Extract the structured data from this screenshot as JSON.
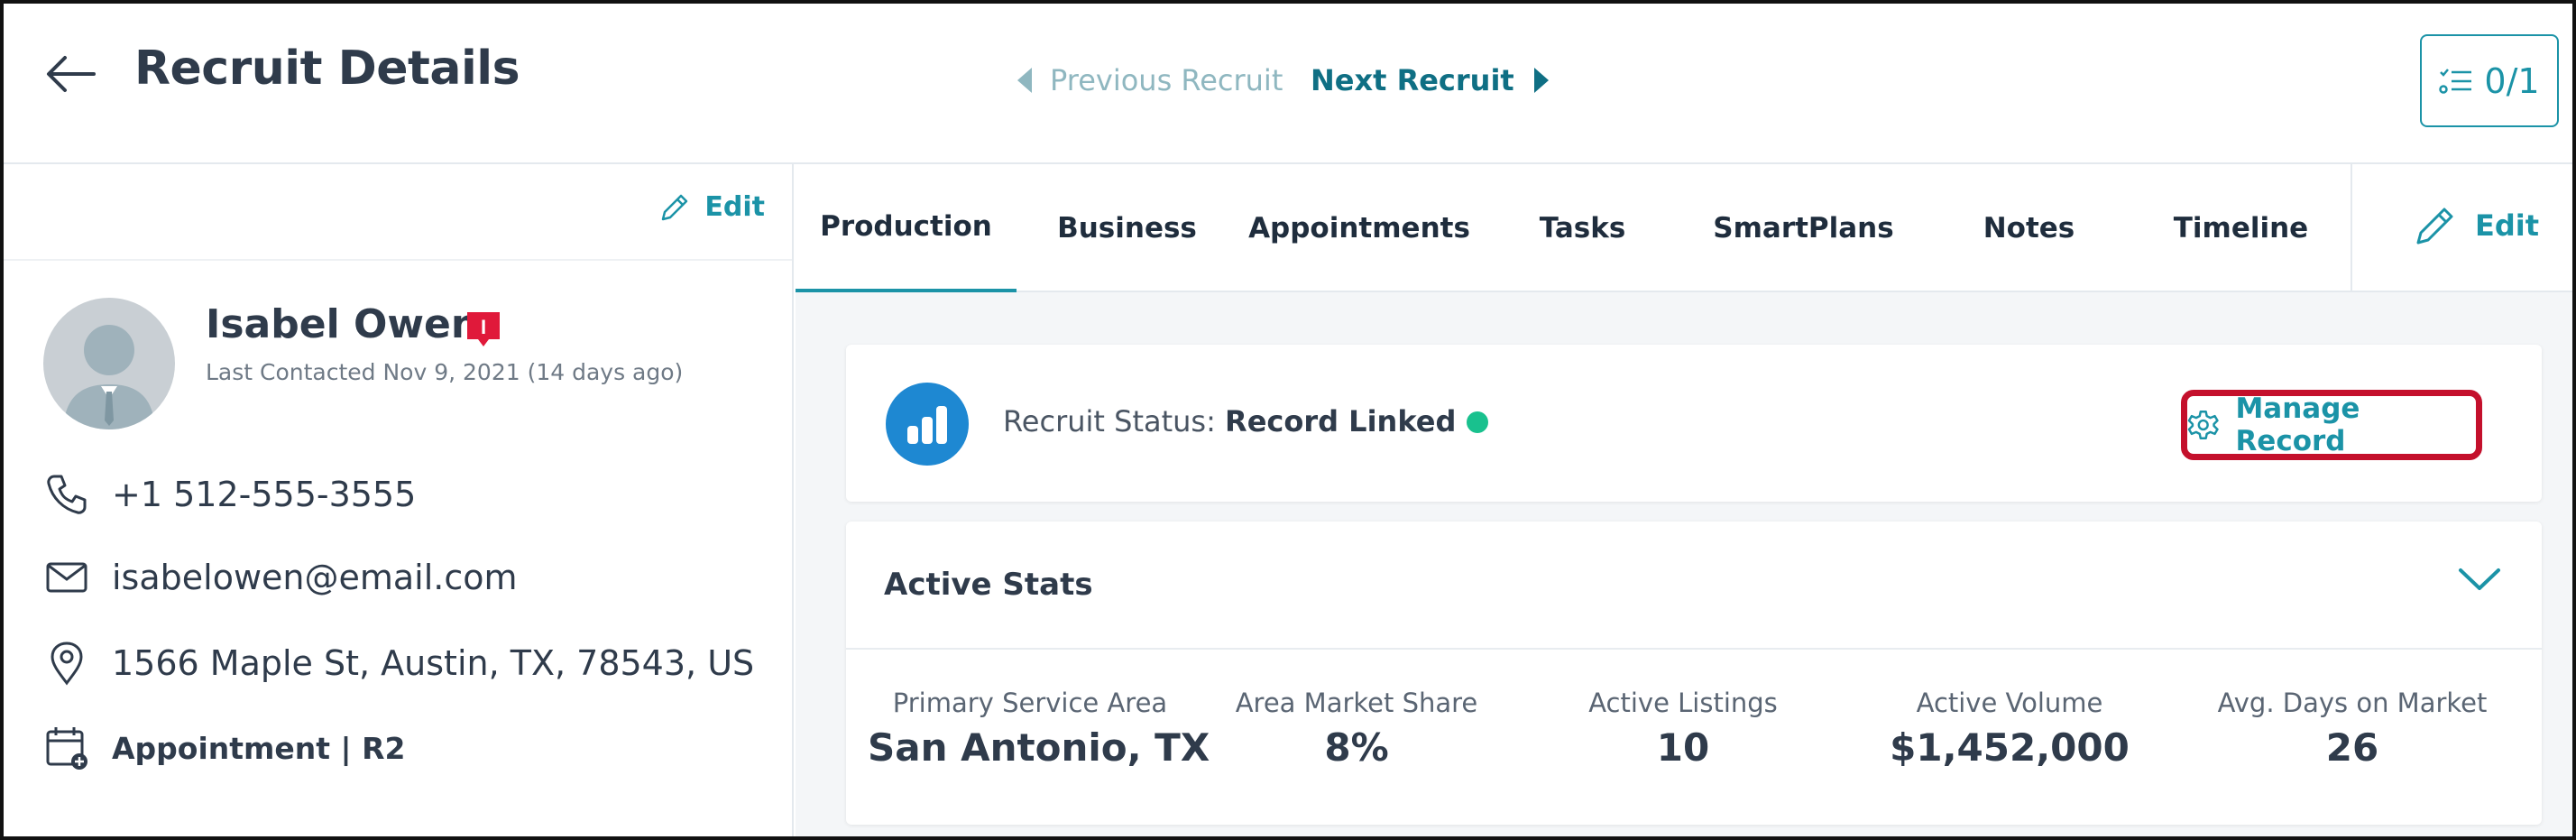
{
  "header": {
    "title": "Recruit Details",
    "previous_label": "Previous Recruit",
    "next_label": "Next Recruit",
    "counter": "0/1"
  },
  "profile": {
    "edit_label": "Edit",
    "name": "Isabel Owen",
    "badge_letter": "I",
    "last_contacted": "Last Contacted Nov 9, 2021 (14 days ago)",
    "phone": "+1 512-555-3555",
    "email": "isabelowen@email.com",
    "address": "1566 Maple St, Austin, TX, 78543, US",
    "appointment": "Appointment | R2"
  },
  "tabs": [
    {
      "label": "Production",
      "active": true
    },
    {
      "label": "Business",
      "active": false
    },
    {
      "label": "Appointments",
      "active": false
    },
    {
      "label": "Tasks",
      "active": false
    },
    {
      "label": "SmartPlans",
      "active": false
    },
    {
      "label": "Notes",
      "active": false
    },
    {
      "label": "Timeline",
      "active": false
    }
  ],
  "tabs_edit_label": "Edit",
  "status": {
    "label": "Recruit Status:",
    "value": "Record Linked",
    "manage_label": "Manage Record"
  },
  "stats": {
    "title": "Active Stats",
    "items": [
      {
        "label": "Primary Service Area",
        "value": "San Antonio, TX"
      },
      {
        "label": "Area Market Share",
        "value": "8%"
      },
      {
        "label": "Active Listings",
        "value": "10"
      },
      {
        "label": "Active Volume",
        "value": "$1,452,000"
      },
      {
        "label": "Avg. Days on Market",
        "value": "26"
      }
    ]
  },
  "icons": {
    "back": "arrow-left-icon",
    "prev": "caret-left-icon",
    "next": "caret-right-icon",
    "counter": "checklist-icon",
    "edit": "pencil-icon",
    "badge": "badge-icon",
    "phone": "phone-icon",
    "email": "envelope-icon",
    "address": "map-pin-icon",
    "appointment": "calendar-add-icon",
    "status": "bar-chart-icon",
    "manage": "gear-icon",
    "collapse": "chevron-down-icon"
  },
  "colors": {
    "accent": "#1b93a7",
    "highlight_border": "#c4102c",
    "status_dot": "#19c18e",
    "badge": "#e0193a",
    "status_icon_bg": "#1e88d2"
  }
}
